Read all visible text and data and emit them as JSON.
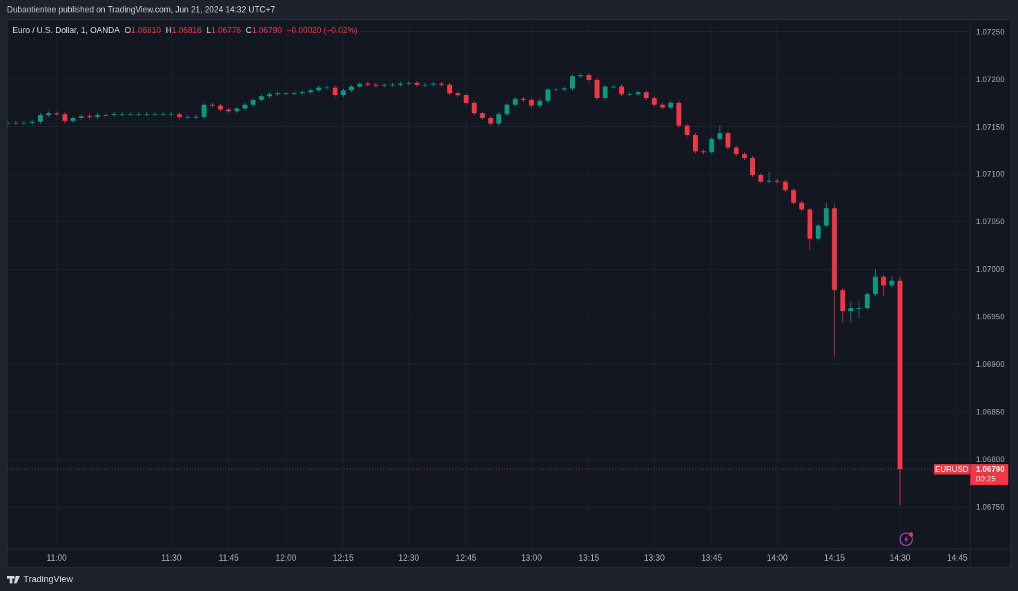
{
  "attribution": "Dubaotientee published on TradingView.com, Jun 21, 2024 14:32 UTC+7",
  "legend": {
    "symbol": "Euro / U.S. Dollar, 1, OANDA",
    "fields": [
      {
        "label": "O",
        "value": "1.06810",
        "color": "#f23645"
      },
      {
        "label": "H",
        "value": "1.06816",
        "color": "#f23645"
      },
      {
        "label": "L",
        "value": "1.06776",
        "color": "#f23645"
      },
      {
        "label": "C",
        "value": "1.06790",
        "color": "#f23645"
      }
    ],
    "change": {
      "text": "−0.00020 (−0.02%)",
      "color": "#f23645"
    }
  },
  "price_tag": {
    "symbol": "EURUSD",
    "countdown": "00:25"
  },
  "chart_data": {
    "type": "candlestick",
    "grid": true,
    "ylim": [
      1.06706,
      1.07262
    ],
    "yticks": [
      {
        "value": 1.0675,
        "label": "1.06750"
      },
      {
        "value": 1.068,
        "label": "1.06800"
      },
      {
        "value": 1.0685,
        "label": "1.06850"
      },
      {
        "value": 1.069,
        "label": "1.06900"
      },
      {
        "value": 1.0695,
        "label": "1.06950"
      },
      {
        "value": 1.07,
        "label": "1.07000"
      },
      {
        "value": 1.0705,
        "label": "1.07050"
      },
      {
        "value": 1.071,
        "label": "1.07100"
      },
      {
        "value": 1.0715,
        "label": "1.07150"
      },
      {
        "value": 1.072,
        "label": "1.07200"
      },
      {
        "value": 1.0725,
        "label": "1.07250"
      }
    ],
    "ref_lines": [
      {
        "axis": "y",
        "value": 1.0679,
        "label": "1.06790",
        "color": "#f23645"
      }
    ],
    "categories": [
      null,
      null,
      null,
      null,
      null,
      null,
      "11:00",
      null,
      null,
      null,
      null,
      null,
      null,
      null,
      null,
      null,
      null,
      null,
      null,
      null,
      "11:30",
      null,
      null,
      null,
      null,
      null,
      null,
      "11:45",
      null,
      null,
      null,
      null,
      null,
      null,
      "12:00",
      null,
      null,
      null,
      null,
      null,
      null,
      "12:15",
      null,
      null,
      null,
      null,
      null,
      null,
      null,
      "12:30",
      null,
      null,
      null,
      null,
      null,
      null,
      "12:45",
      null,
      null,
      null,
      null,
      null,
      null,
      null,
      "13:00",
      null,
      null,
      null,
      null,
      null,
      null,
      "13:15",
      null,
      null,
      null,
      null,
      null,
      null,
      null,
      "13:30",
      null,
      null,
      null,
      null,
      null,
      null,
      "13:45",
      null,
      null,
      null,
      null,
      null,
      null,
      null,
      "14:00",
      null,
      null,
      null,
      null,
      null,
      null,
      "14:15",
      null,
      null,
      null,
      null,
      null,
      null,
      null,
      "14:30",
      null,
      null,
      null,
      null,
      null,
      null,
      "14:45",
      null
    ],
    "ohlc": [
      [
        1.07153,
        1.07156,
        1.07151,
        1.07154
      ],
      [
        1.07154,
        1.07156,
        1.07152,
        1.07154
      ],
      [
        1.07154,
        1.07156,
        1.07152,
        1.07154
      ],
      [
        1.07154,
        1.07157,
        1.07152,
        1.07155
      ],
      [
        1.07155,
        1.07164,
        1.07153,
        1.07162
      ],
      [
        1.07162,
        1.07166,
        1.0716,
        1.07164
      ],
      [
        1.07164,
        1.07166,
        1.07161,
        1.07163
      ],
      [
        1.07163,
        1.07165,
        1.07154,
        1.07156
      ],
      [
        1.07156,
        1.07161,
        1.07154,
        1.07159
      ],
      [
        1.07159,
        1.07163,
        1.07157,
        1.07161
      ],
      [
        1.07161,
        1.07163,
        1.07158,
        1.0716
      ],
      [
        1.0716,
        1.07164,
        1.07158,
        1.07162
      ],
      [
        1.07162,
        1.07164,
        1.0716,
        1.07162
      ],
      [
        1.07162,
        1.07165,
        1.0716,
        1.07163
      ],
      [
        1.07163,
        1.07165,
        1.07161,
        1.07163
      ],
      [
        1.07163,
        1.07165,
        1.07161,
        1.07163
      ],
      [
        1.07163,
        1.07165,
        1.07161,
        1.07163
      ],
      [
        1.07163,
        1.07165,
        1.07161,
        1.07163
      ],
      [
        1.07163,
        1.07165,
        1.07161,
        1.07163
      ],
      [
        1.07163,
        1.07165,
        1.07161,
        1.07163
      ],
      [
        1.07163,
        1.07165,
        1.07161,
        1.07163
      ],
      [
        1.07163,
        1.07165,
        1.07158,
        1.0716
      ],
      [
        1.0716,
        1.07162,
        1.07158,
        1.0716
      ],
      [
        1.0716,
        1.07162,
        1.07158,
        1.0716
      ],
      [
        1.0716,
        1.07175,
        1.07158,
        1.07173
      ],
      [
        1.07173,
        1.07175,
        1.0717,
        1.07172
      ],
      [
        1.07172,
        1.07174,
        1.07166,
        1.07168
      ],
      [
        1.07168,
        1.0717,
        1.07164,
        1.07166
      ],
      [
        1.07166,
        1.07171,
        1.07164,
        1.07169
      ],
      [
        1.07169,
        1.07175,
        1.07167,
        1.07173
      ],
      [
        1.07173,
        1.0718,
        1.07171,
        1.07178
      ],
      [
        1.07178,
        1.07184,
        1.07176,
        1.07182
      ],
      [
        1.07182,
        1.07186,
        1.0718,
        1.07184
      ],
      [
        1.07184,
        1.07187,
        1.07182,
        1.07185
      ],
      [
        1.07185,
        1.07187,
        1.07183,
        1.07185
      ],
      [
        1.07185,
        1.07187,
        1.07183,
        1.07185
      ],
      [
        1.07185,
        1.07188,
        1.07183,
        1.07186
      ],
      [
        1.07186,
        1.0719,
        1.07184,
        1.07188
      ],
      [
        1.07188,
        1.07193,
        1.07186,
        1.07191
      ],
      [
        1.07191,
        1.07193,
        1.07189,
        1.07191
      ],
      [
        1.07191,
        1.07193,
        1.07181,
        1.07183
      ],
      [
        1.07183,
        1.0719,
        1.07181,
        1.07188
      ],
      [
        1.07188,
        1.07194,
        1.07186,
        1.07192
      ],
      [
        1.07192,
        1.07197,
        1.0719,
        1.07195
      ],
      [
        1.07195,
        1.07197,
        1.07192,
        1.07194
      ],
      [
        1.07194,
        1.07196,
        1.07191,
        1.07193
      ],
      [
        1.07193,
        1.07196,
        1.07191,
        1.07194
      ],
      [
        1.07194,
        1.07196,
        1.07192,
        1.07194
      ],
      [
        1.07194,
        1.07197,
        1.07192,
        1.07195
      ],
      [
        1.07195,
        1.07198,
        1.07193,
        1.07196
      ],
      [
        1.07196,
        1.07198,
        1.07192,
        1.07194
      ],
      [
        1.07194,
        1.07196,
        1.07192,
        1.07194
      ],
      [
        1.07194,
        1.07197,
        1.07192,
        1.07195
      ],
      [
        1.07195,
        1.07197,
        1.07192,
        1.07194
      ],
      [
        1.07194,
        1.07196,
        1.07183,
        1.07185
      ],
      [
        1.07185,
        1.07187,
        1.07181,
        1.07183
      ],
      [
        1.07183,
        1.07185,
        1.07173,
        1.07175
      ],
      [
        1.07175,
        1.07177,
        1.07162,
        1.07164
      ],
      [
        1.07164,
        1.07166,
        1.07157,
        1.07159
      ],
      [
        1.07159,
        1.07161,
        1.07151,
        1.07153
      ],
      [
        1.07153,
        1.07165,
        1.07151,
        1.07163
      ],
      [
        1.07163,
        1.07175,
        1.07161,
        1.07173
      ],
      [
        1.07173,
        1.07181,
        1.07171,
        1.07179
      ],
      [
        1.07179,
        1.07181,
        1.07176,
        1.07178
      ],
      [
        1.07178,
        1.0718,
        1.0717,
        1.07172
      ],
      [
        1.07172,
        1.07179,
        1.0717,
        1.07177
      ],
      [
        1.07177,
        1.07191,
        1.07175,
        1.07189
      ],
      [
        1.07189,
        1.07191,
        1.07187,
        1.07189
      ],
      [
        1.07189,
        1.07192,
        1.07187,
        1.0719
      ],
      [
        1.0719,
        1.07205,
        1.07188,
        1.07203
      ],
      [
        1.07203,
        1.07206,
        1.07201,
        1.07204
      ],
      [
        1.07204,
        1.07206,
        1.07197,
        1.07199
      ],
      [
        1.07199,
        1.07201,
        1.07178,
        1.0718
      ],
      [
        1.0718,
        1.07194,
        1.07178,
        1.07192
      ],
      [
        1.07192,
        1.07194,
        1.0719,
        1.07192
      ],
      [
        1.07192,
        1.07194,
        1.07182,
        1.07184
      ],
      [
        1.07184,
        1.07186,
        1.07182,
        1.07184
      ],
      [
        1.07184,
        1.07188,
        1.07182,
        1.07186
      ],
      [
        1.07186,
        1.07188,
        1.07178,
        1.0718
      ],
      [
        1.0718,
        1.07182,
        1.07171,
        1.07173
      ],
      [
        1.07173,
        1.07175,
        1.07168,
        1.0717
      ],
      [
        1.0717,
        1.07177,
        1.07168,
        1.07175
      ],
      [
        1.07175,
        1.07177,
        1.07149,
        1.07151
      ],
      [
        1.07151,
        1.07153,
        1.07139,
        1.07141
      ],
      [
        1.07141,
        1.07143,
        1.07122,
        1.07124
      ],
      [
        1.07124,
        1.07126,
        1.07121,
        1.07123
      ],
      [
        1.07123,
        1.07139,
        1.07121,
        1.07137
      ],
      [
        1.07137,
        1.07151,
        1.07135,
        1.07143
      ],
      [
        1.07143,
        1.07145,
        1.07126,
        1.07128
      ],
      [
        1.07128,
        1.0713,
        1.07119,
        1.07121
      ],
      [
        1.07121,
        1.07123,
        1.07115,
        1.07117
      ],
      [
        1.07117,
        1.07119,
        1.07097,
        1.07099
      ],
      [
        1.07099,
        1.07101,
        1.0709,
        1.07092
      ],
      [
        1.07092,
        1.07102,
        1.0709,
        1.07093
      ],
      [
        1.07093,
        1.07095,
        1.0709,
        1.07092
      ],
      [
        1.07092,
        1.07094,
        1.07081,
        1.07083
      ],
      [
        1.07083,
        1.07085,
        1.07068,
        1.0707
      ],
      [
        1.0707,
        1.07072,
        1.07061,
        1.07063
      ],
      [
        1.07063,
        1.07065,
        1.0702,
        1.07032
      ],
      [
        1.07032,
        1.07048,
        1.0703,
        1.07046
      ],
      [
        1.07046,
        1.0707,
        1.07044,
        1.07064
      ],
      [
        1.07064,
        1.07068,
        1.06908,
        1.06978
      ],
      [
        1.06978,
        1.0698,
        1.06944,
        1.06956
      ],
      [
        1.06956,
        1.06966,
        1.06944,
        1.06959
      ],
      [
        1.06959,
        1.06967,
        1.06948,
        1.06959
      ],
      [
        1.06959,
        1.06976,
        1.06957,
        1.06974
      ],
      [
        1.06974,
        1.07,
        1.06972,
        1.06992
      ],
      [
        1.06992,
        1.06994,
        1.06972,
        1.06983
      ],
      [
        1.06983,
        1.06993,
        1.06981,
        1.06988
      ],
      [
        1.06988,
        1.06992,
        1.06752,
        1.0679
      ],
      null,
      null,
      null,
      null,
      null,
      null,
      null,
      null
    ]
  },
  "footer": {
    "brand": "TradingView"
  }
}
